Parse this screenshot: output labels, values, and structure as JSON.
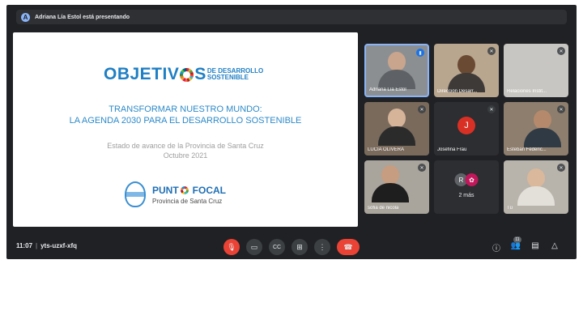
{
  "presenting_bar": {
    "initial": "A",
    "text": "Adriana Lía Estol está presentando"
  },
  "slide": {
    "logo_big_1": "OBJETIV",
    "logo_big_2": "S",
    "logo_small_1": "DE DESARROLLO",
    "logo_small_2": "SOSTENIBLE",
    "headline_1": "TRANSFORMAR NUESTRO MUNDO:",
    "headline_2": "LA AGENDA 2030 PARA EL DESARROLLO SOSTENIBLE",
    "status_1": "Estado de avance de la Provincia de Santa Cruz",
    "status_2": "Octubre 2021",
    "focal_1": "PUNT",
    "focal_2": "FOCAL",
    "focal_sub": "Provincia de Santa Cruz"
  },
  "participants": [
    {
      "name": "Adriana Lía Estol",
      "muted": false
    },
    {
      "name": "Dirección Desarr...",
      "muted": true
    },
    {
      "name": "Relaciones Instit...",
      "muted": true
    },
    {
      "name": "LUCIA OLIVERA",
      "muted": true
    },
    {
      "name": "Josefina Frau",
      "initial": "J",
      "muted": true
    },
    {
      "name": "Esteban Federic...",
      "muted": true
    },
    {
      "name": "sofia de nicola",
      "muted": true
    },
    {
      "more_label": "2 más",
      "initial": "R"
    },
    {
      "name": "Tú",
      "muted": true
    }
  ],
  "bottom_bar": {
    "time": "11:07",
    "separator": "|",
    "meeting_code": "yts-uzxf-xfq",
    "participants_count": "11"
  },
  "icons": {
    "mic": "mic-off-icon",
    "camera": "camera-icon",
    "captions": "captions-icon",
    "present": "present-icon",
    "more": "more-vertical-icon",
    "hangup": "hang-up-icon",
    "info": "info-icon",
    "people": "people-icon",
    "chat": "chat-icon",
    "activities": "activities-icon"
  },
  "colors": {
    "accent": "#1f7fc4",
    "meet_bg": "#202124",
    "danger": "#ea4335"
  }
}
